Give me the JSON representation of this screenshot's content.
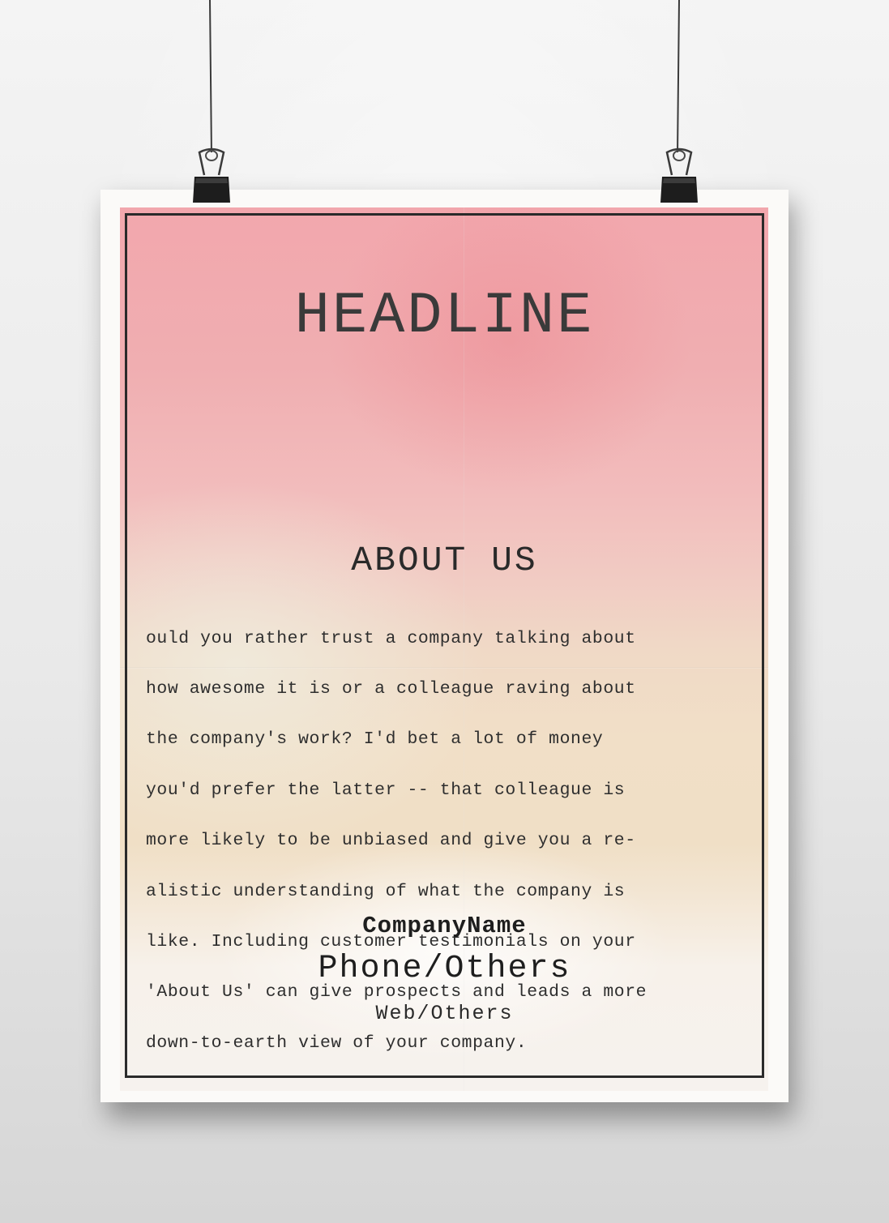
{
  "poster": {
    "headline": "HEADLINE",
    "about_title": "ABOUT US",
    "about_body_lines": [
      "ould you rather trust a company talking about",
      "how awesome it is or a colleague raving about",
      "the company's work? I'd bet a lot of money",
      "you'd prefer the latter -- that colleague is",
      "more likely to be unbiased and give you a re-",
      "alistic understanding of what the company is",
      "like. Including customer testimonials on your",
      "'About Us' can give prospects and leads a more",
      "down-to-earth view of your company."
    ],
    "company_name": "CompanyName",
    "phone": "Phone/Others",
    "web": "Web/Others"
  },
  "colors": {
    "wall": "#ececec",
    "paper_pink": "#f2a7ad",
    "paper_cream": "#f0dfc6",
    "frame": "#2a2a2a",
    "text": "#2e2e2e"
  },
  "icons": {
    "left_clip": "binder-clip-icon",
    "right_clip": "binder-clip-icon"
  }
}
